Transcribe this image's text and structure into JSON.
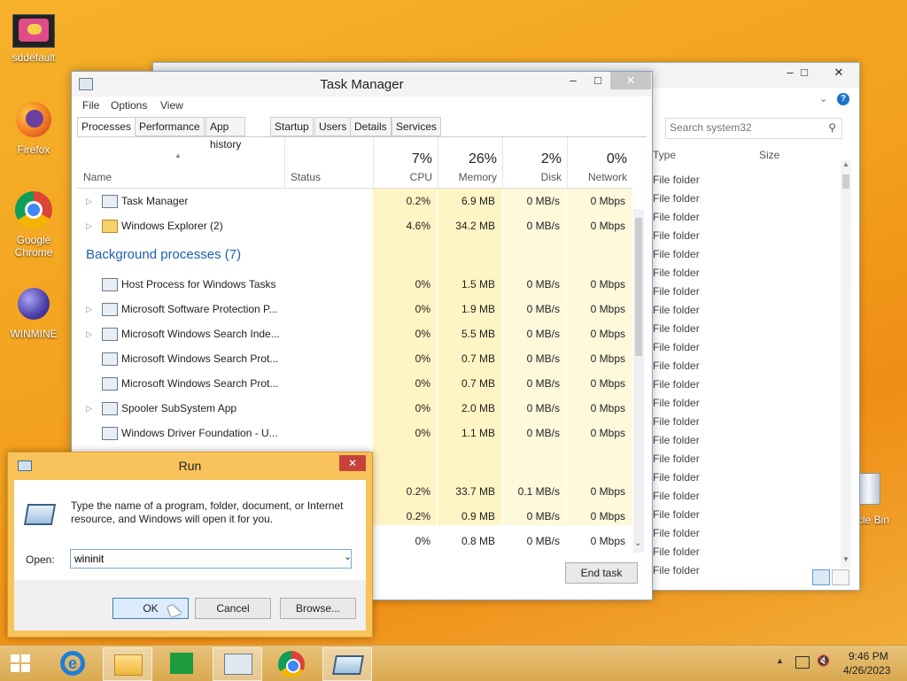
{
  "desktop": {
    "icons": [
      {
        "label": "sddefault"
      },
      {
        "label": "Firefox"
      },
      {
        "label": "Google Chrome"
      },
      {
        "label": "WINMINE"
      },
      {
        "label": "cle Bin"
      }
    ]
  },
  "explorer": {
    "search_placeholder": "Search system32",
    "col_type": "Type",
    "col_size": "Size",
    "rows": [
      "File folder",
      "File folder",
      "File folder",
      "File folder",
      "File folder",
      "File folder",
      "File folder",
      "File folder",
      "File folder",
      "File folder",
      "File folder",
      "File folder",
      "File folder",
      "File folder",
      "File folder",
      "File folder",
      "File folder",
      "File folder",
      "File folder",
      "File folder",
      "File folder",
      "File folder"
    ]
  },
  "task_manager": {
    "title": "Task Manager",
    "menu": [
      "File",
      "Options",
      "View"
    ],
    "tabs": [
      "Processes",
      "Performance",
      "App history",
      "Startup",
      "Users",
      "Details",
      "Services"
    ],
    "columns": {
      "name": "Name",
      "status": "Status",
      "cpu": {
        "pct": "7%",
        "label": "CPU"
      },
      "memory": {
        "pct": "26%",
        "label": "Memory"
      },
      "disk": {
        "pct": "2%",
        "label": "Disk"
      },
      "network": {
        "pct": "0%",
        "label": "Network"
      }
    },
    "apps": [
      {
        "name": "Task Manager",
        "cpu": "0.2%",
        "mem": "6.9 MB",
        "disk": "0 MB/s",
        "net": "0 Mbps"
      },
      {
        "name": "Windows Explorer (2)",
        "cpu": "4.6%",
        "mem": "34.2 MB",
        "disk": "0 MB/s",
        "net": "0 Mbps"
      }
    ],
    "bg_title": "Background processes (7)",
    "bg": [
      {
        "name": "Host Process for Windows Tasks",
        "cpu": "0%",
        "mem": "1.5 MB",
        "disk": "0 MB/s",
        "net": "0 Mbps"
      },
      {
        "name": "Microsoft Software Protection P...",
        "cpu": "0%",
        "mem": "1.9 MB",
        "disk": "0 MB/s",
        "net": "0 Mbps"
      },
      {
        "name": "Microsoft Windows Search Inde...",
        "cpu": "0%",
        "mem": "5.5 MB",
        "disk": "0 MB/s",
        "net": "0 Mbps"
      },
      {
        "name": "Microsoft Windows Search Prot...",
        "cpu": "0%",
        "mem": "0.7 MB",
        "disk": "0 MB/s",
        "net": "0 Mbps"
      },
      {
        "name": "Microsoft Windows Search Prot...",
        "cpu": "0%",
        "mem": "0.7 MB",
        "disk": "0 MB/s",
        "net": "0 Mbps"
      },
      {
        "name": "Spooler SubSystem App",
        "cpu": "0%",
        "mem": "2.0 MB",
        "disk": "0 MB/s",
        "net": "0 Mbps"
      },
      {
        "name": "Windows Driver Foundation - U...",
        "cpu": "0%",
        "mem": "1.1 MB",
        "disk": "0 MB/s",
        "net": "0 Mbps"
      }
    ],
    "hidden_rows": [
      {
        "cpu": "0.2%",
        "mem": "33.7 MB",
        "disk": "0.1 MB/s",
        "net": "0 Mbps"
      },
      {
        "cpu": "0.2%",
        "mem": "0.9 MB",
        "disk": "0 MB/s",
        "net": "0 Mbps"
      },
      {
        "cpu": "0%",
        "mem": "0.8 MB",
        "disk": "0 MB/s",
        "net": "0 Mbps"
      }
    ],
    "end_task": "End task"
  },
  "run": {
    "title": "Run",
    "description": "Type the name of a program, folder, document, or Internet resource, and Windows will open it for you.",
    "open_label": "Open:",
    "open_value": "wininit",
    "ok": "OK",
    "cancel": "Cancel",
    "browse": "Browse..."
  },
  "taskbar": {
    "time": "9:46 PM",
    "date": "4/26/2023"
  }
}
